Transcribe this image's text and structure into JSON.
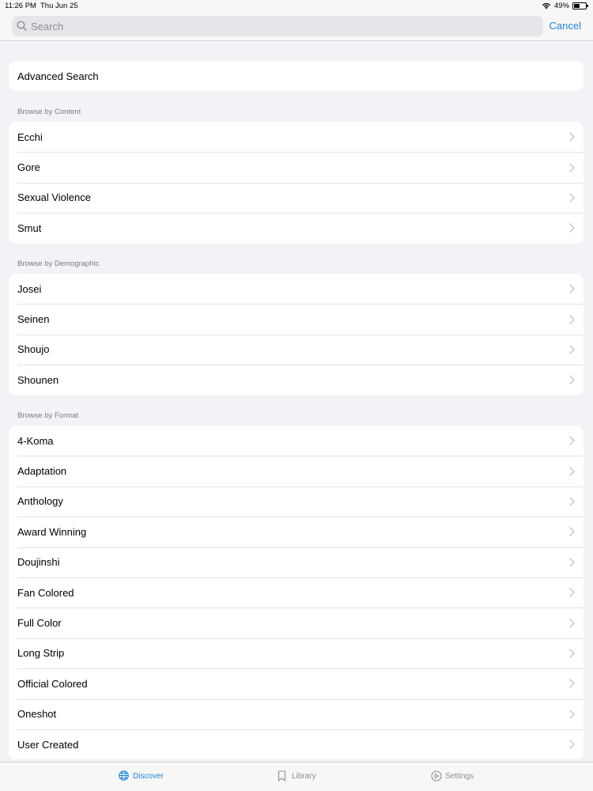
{
  "status_bar": {
    "time": "11:26 PM",
    "date": "Thu Jun 25",
    "battery_text": "49%",
    "battery_level": 0.49,
    "wifi_icon": "wifi-icon",
    "battery_icon": "battery-icon"
  },
  "search": {
    "placeholder": "Search",
    "value": "",
    "icon": "search-icon",
    "cancel_label": "Cancel"
  },
  "advanced_search": {
    "label": "Advanced Search"
  },
  "sections": {
    "content": {
      "header": "Browse by Content",
      "items": [
        "Ecchi",
        "Gore",
        "Sexual Violence",
        "Smut"
      ]
    },
    "demographic": {
      "header": "Browse by Demographic",
      "items": [
        "Josei",
        "Seinen",
        "Shoujo",
        "Shounen"
      ]
    },
    "format": {
      "header": "Browse by Format",
      "items": [
        "4-Koma",
        "Adaptation",
        "Anthology",
        "Award Winning",
        "Doujinshi",
        "Fan Colored",
        "Full Color",
        "Long Strip",
        "Official Colored",
        "Oneshot",
        "User Created"
      ]
    }
  },
  "tab_bar": {
    "tabs": [
      {
        "label": "Discover",
        "icon": "globe-icon",
        "active": true
      },
      {
        "label": "Library",
        "icon": "bookmark-icon",
        "active": false
      },
      {
        "label": "Settings",
        "icon": "gear-icon",
        "active": false
      }
    ]
  },
  "colors": {
    "accent": "#1a86e0",
    "background": "#f2f2f7",
    "card": "#ffffff",
    "secondary_text": "#7b7b80",
    "chevron": "#c4c4c7"
  }
}
